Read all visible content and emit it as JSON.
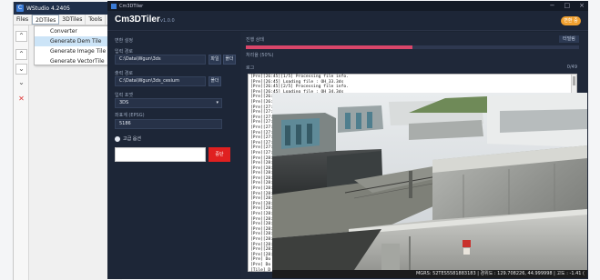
{
  "wstudio": {
    "title": "WStudio 4.2405",
    "menu": [
      "Files",
      "2DTiles",
      "3DTiles",
      "Tools"
    ],
    "dropdown": {
      "items": [
        "Converter",
        "Generate Dem Tile",
        "Generate Image Tile",
        "Generate VectorTile"
      ],
      "selected_index": 1
    },
    "side_icons": [
      "chevron-double-up-icon",
      "chevron-up-icon",
      "chevron-down-icon",
      "chevron-double-down-icon",
      "close-icon"
    ]
  },
  "tiler": {
    "window_title": "Cm3DTiler",
    "app_title": "Cm3DTiler",
    "version": "v1.0.0",
    "badge": "변환 중",
    "window_controls": [
      "−",
      "□",
      "×"
    ],
    "settings": {
      "heading": "변환 설정",
      "input_label": "입력 경로",
      "input_path": "C:\\Data\\Wgun\\3ds",
      "input_btn1": "파일",
      "input_btn2": "폴더",
      "output_label": "출력 경로",
      "output_path": "C:\\Data\\Wgun\\3ds_cesium",
      "output_btn": "폴더",
      "format_label": "입력 포맷",
      "format_value": "3DS",
      "epsg_label": "좌표계 (EPSG)",
      "epsg_value": "5186",
      "check_label": "고급 옵션",
      "stop_label": "중단"
    },
    "status": {
      "heading": "진행 상태",
      "open_btn": "터밀림",
      "progress_percent": 50,
      "progress_text": "처리율 (50%)",
      "log_heading": "로그",
      "log_count": "0/49",
      "log_lines": [
        "[Pre][26:45][1/5] Processing file info.",
        "[Pre][26:45] Loading file : OH_33.3ds",
        "[Pre][26:45][2/5] Processing file info.",
        "[Pre][26:45] Loading file : OH_34.3ds",
        "[Pre][26:4",
        "[Pre][26:4",
        "[Pre][27:0",
        "[Pre][27:0",
        "[Pre][27:0",
        "[Pre][27:0",
        "[Pre][27:1",
        "[Pre][27:1",
        "[Pre][27:1",
        "[Pre][27:1",
        "[Pre][27:2",
        "[Pre][27:2",
        "[Pre][28:",
        "[Pre][28:",
        "[Pre][28:",
        "[Pre][28:",
        "[Pre][28:",
        "[Pre][28:",
        "[Pre][28:",
        "[Pre][28:",
        "[Pre][28:",
        "[Pre][28:",
        "[Pre][28:",
        "[Pre][28:",
        "[Pre][28:",
        "[Pre][28:",
        "[Pre][28:",
        "[Pre][28:",
        "[Pre][28:",
        "[Pre][28:",
        "[Pre][28:",
        "[Pre][28:",
        "[Pre] Do",
        "[Pre] Do",
        "[Tile] D"
      ]
    }
  },
  "viewer": {
    "status_text": "MGRS: 52TES5581883183 | 경위도 : 129.708226, 44.999998 | 고도 : -1.41 ("
  }
}
